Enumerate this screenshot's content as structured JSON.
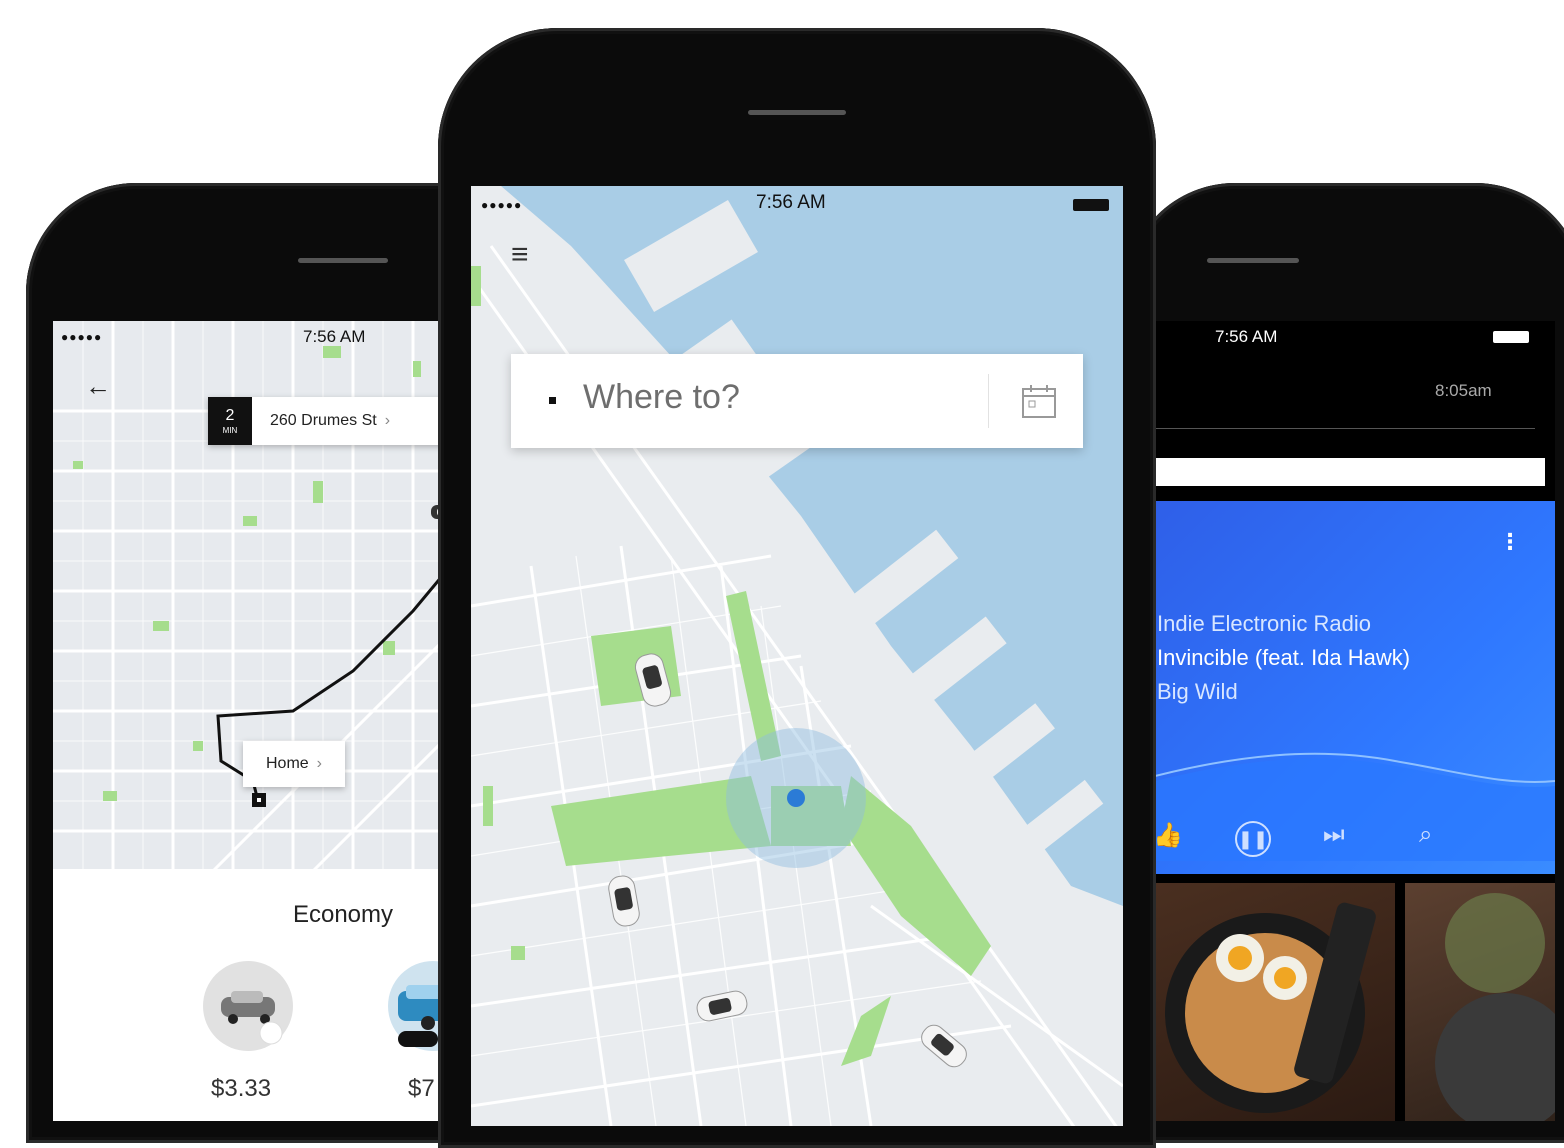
{
  "left_phone": {
    "status": {
      "signal": "●●●●●",
      "time": "7:56 AM"
    },
    "back_icon": "←",
    "pickup_card": {
      "eta_value": "2",
      "eta_unit": "MIN",
      "address": "260 Drumes St",
      "chevron": "›"
    },
    "home_card": {
      "label": "Home",
      "chevron": "›"
    },
    "sheet": {
      "title": "Economy",
      "rides": [
        {
          "price": "$3.33"
        },
        {
          "price": "$7"
        }
      ]
    }
  },
  "center_phone": {
    "status": {
      "signal": "●●●●●",
      "time": "7:56 AM"
    },
    "menu_icon": "≡",
    "search": {
      "placeholder": "Where to?"
    }
  },
  "right_phone": {
    "status": {
      "time": "7:56 AM"
    },
    "arrival": "8:05am",
    "music": {
      "station": "Indie Electronic Radio",
      "track": "Invincible (feat. Ida Hawk)",
      "artist": "Big Wild"
    }
  },
  "colors": {
    "map_bg": "#e9ecef",
    "water": "#a9cde6",
    "park": "#a6dd8d",
    "music_blue": "#2f6cf3",
    "phone": "#0b0b0b"
  }
}
